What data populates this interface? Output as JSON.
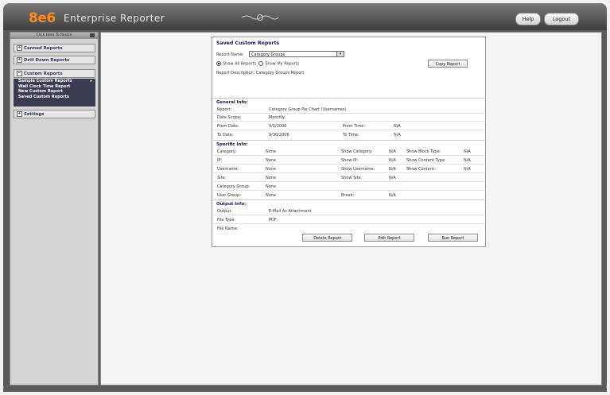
{
  "header": {
    "logo": "8e6",
    "app_title": "Enterprise Reporter",
    "help_label": "Help",
    "logout_label": "Logout"
  },
  "sidebar": {
    "collapse_label": "Click Here To Resize",
    "canned_reports": "Canned Reports",
    "drill_down_reports": "Drill Down Reports",
    "custom_reports": "Custom Reports",
    "settings": "Settings",
    "custom_items": [
      "Sample Custom Reports",
      "Wall Clock Time Report",
      "New Custom Report",
      "Saved Custom Reports"
    ],
    "arrow": "▸"
  },
  "panel": {
    "title": "Saved Custom Reports",
    "report_name_label": "Report Name:",
    "report_name_value": "Category Groups",
    "radio_all": "Show All Reports",
    "radio_mine": "Show My Reports",
    "copy_button": "Copy Report",
    "description": "Report Description: Category Groups Report",
    "general_title": "General Info:",
    "general": {
      "report_label": "Report:",
      "report_value": "Category Group Pie Chart (Usernames)",
      "date_scope_label": "Date Scope:",
      "date_scope_value": "Monthly",
      "from_date_label": "From Date:",
      "from_date_value": "9/1/2006",
      "from_time_label": "From Time:",
      "from_time_value": "N/A",
      "to_date_label": "To Date:",
      "to_date_value": "9/30/2006",
      "to_time_label": "To Time:",
      "to_time_value": "N/A"
    },
    "specific_title": "Specific Info:",
    "specific": [
      {
        "l1": "Category:",
        "v1": "None",
        "l2": "Show Category:",
        "v2": "N/A",
        "l3": "Show Block Type:",
        "v3": "N/A"
      },
      {
        "l1": "IP:",
        "v1": "None",
        "l2": "Show IP:",
        "v2": "N/A",
        "l3": "Show Content Type:",
        "v3": "N/A"
      },
      {
        "l1": "Username:",
        "v1": "None",
        "l2": "Show Username:",
        "v2": "N/A",
        "l3": "Show Content:",
        "v3": "N/A"
      },
      {
        "l1": "Site:",
        "v1": "None",
        "l2": "Show Site:",
        "v2": "N/A",
        "l3": "",
        "v3": ""
      },
      {
        "l1": "Category Group:",
        "v1": "None",
        "l2": "",
        "v2": "",
        "l3": "",
        "v3": ""
      },
      {
        "l1": "User Group:",
        "v1": "None",
        "l2": "Break:",
        "v2": "N/A",
        "l3": "",
        "v3": ""
      }
    ],
    "output_title": "Output Info:",
    "output": {
      "output_label": "Output:",
      "output_value": "E-Mail As Attachment",
      "file_type_label": "File Type:",
      "file_type_value": "PDF",
      "file_name_label": "File Name:",
      "file_name_value": ""
    },
    "delete_button": "Delete Report",
    "edit_button": "Edit Report",
    "run_button": "Run Report"
  },
  "colors": {
    "accent": "#ff8a1e",
    "submenu_bg": "#3b3b52",
    "section_title": "#1a1a55"
  }
}
